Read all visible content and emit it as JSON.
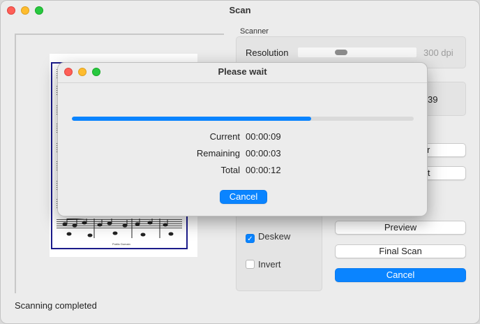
{
  "window": {
    "title": "Scan"
  },
  "scanner": {
    "group_label": "Scanner",
    "resolution_label": "Resolution",
    "resolution_value": "300 dpi",
    "resolution_fraction": 0.35,
    "peek_value": "39"
  },
  "sheet": {
    "publisher": "Public Domain"
  },
  "options": {
    "deskew": {
      "label": "Deskew",
      "checked": true
    },
    "invert": {
      "label": "Invert",
      "checked": false
    }
  },
  "actions": {
    "peek_1": "r",
    "peek_2": "lt",
    "preview": "Preview",
    "final_scan": "Final Scan",
    "cancel": "Cancel"
  },
  "status": {
    "text": "Scanning completed"
  },
  "dialog": {
    "title": "Please wait",
    "progress_percent": 70,
    "rows": [
      {
        "label": "Current",
        "value": "00:00:09"
      },
      {
        "label": "Remaining",
        "value": "00:00:03"
      },
      {
        "label": "Total",
        "value": "00:00:12"
      }
    ],
    "cancel": "Cancel"
  },
  "colors": {
    "accent": "#0a84ff",
    "selection_border": "#1b1b8a"
  },
  "icons": {
    "check": "checkmark-icon"
  }
}
